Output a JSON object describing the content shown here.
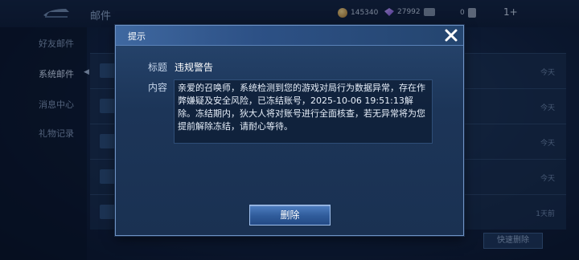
{
  "header": {
    "title": "邮件",
    "coins": "145340",
    "gems": "27992",
    "ticket_count": "0",
    "plus_label": "1+"
  },
  "sidebar": {
    "items": [
      {
        "label": "好友邮件"
      },
      {
        "label": "系统邮件"
      },
      {
        "label": "消息中心"
      },
      {
        "label": "礼物记录"
      }
    ]
  },
  "mail_list": {
    "rows": [
      {
        "date": "今天"
      },
      {
        "date": "今天"
      },
      {
        "date": "今天"
      },
      {
        "date": "今天"
      },
      {
        "date": "1天前"
      }
    ],
    "quick_delete_label": "快速删除"
  },
  "dialog": {
    "title": "提示",
    "subject_label": "标题",
    "subject_value": "违规警告",
    "content_label": "内容",
    "content_text": "亲爱的召唤师，系统检测到您的游戏对局行为数据异常，存在作弊嫌疑及安全风险，已冻结账号，2025-10-06 19:51:13解除。冻结期内，狄大人将对账号进行全面核查，若无异常将为您提前解除冻结，请耐心等待。",
    "delete_label": "删除"
  }
}
